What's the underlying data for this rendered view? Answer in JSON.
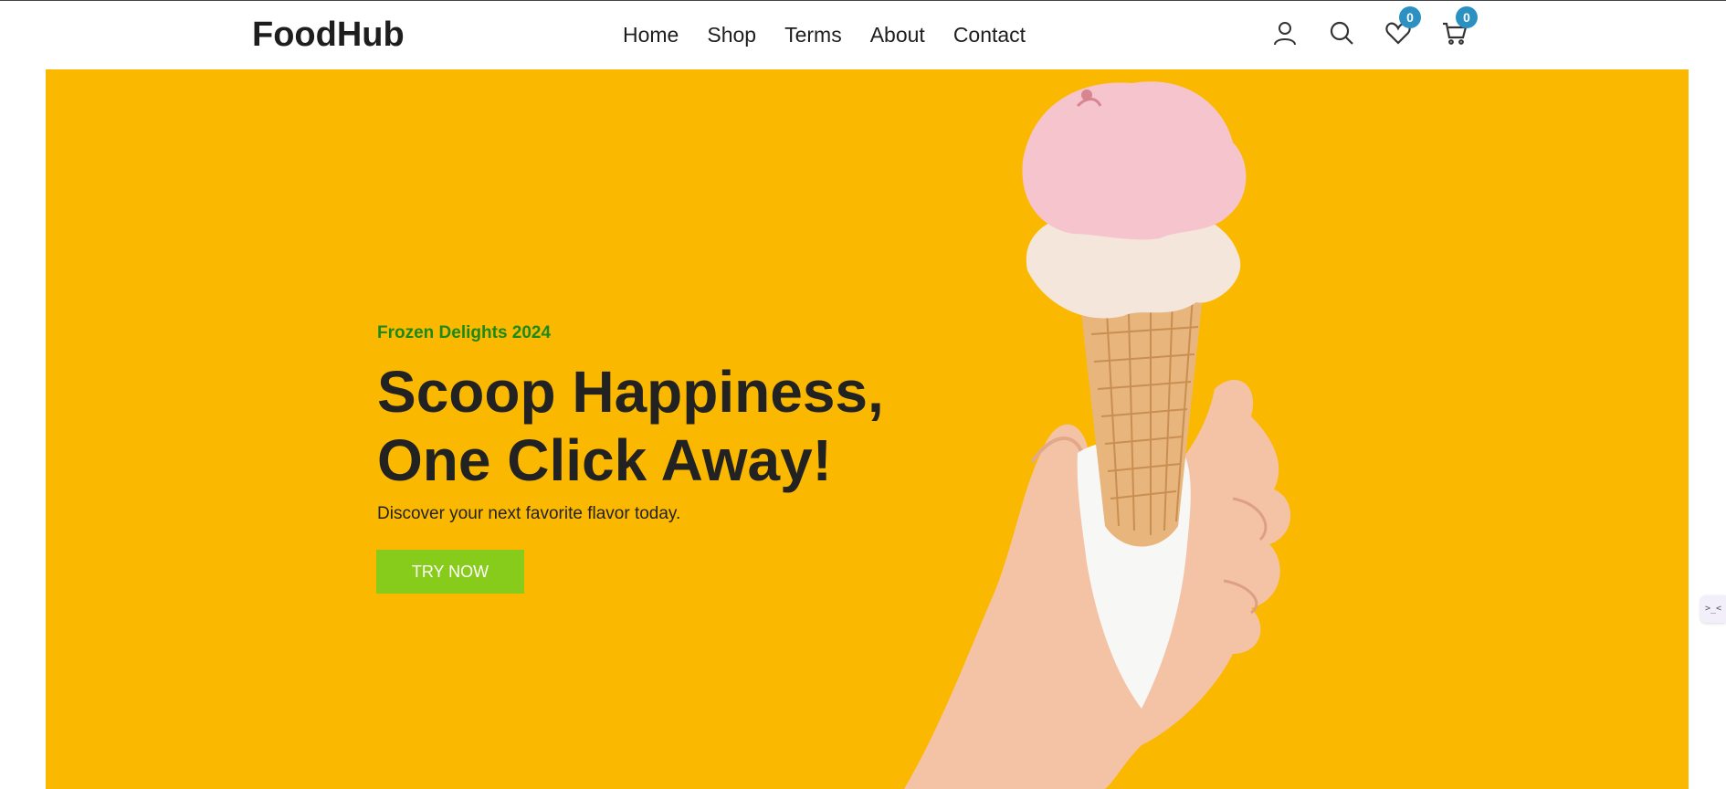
{
  "brand": {
    "name": "FoodHub"
  },
  "nav": {
    "items": [
      {
        "label": "Home"
      },
      {
        "label": "Shop"
      },
      {
        "label": "Terms"
      },
      {
        "label": "About"
      },
      {
        "label": "Contact"
      }
    ]
  },
  "header_icons": {
    "account": "user-icon",
    "search": "search-icon",
    "wishlist": "heart-icon",
    "wishlist_count": "0",
    "cart": "cart-icon",
    "cart_count": "0"
  },
  "hero": {
    "eyebrow": "Frozen Delights 2024",
    "headline_line1": "Scoop Happiness,",
    "headline_line2": "One Click Away!",
    "subtext": "Discover your next favorite flavor today.",
    "cta_label": "TRY NOW",
    "image": "ice-cream-cone-in-hand"
  },
  "side_widget": {
    "glyph": ">_<",
    "icon": "assistant-icon"
  },
  "colors": {
    "hero_background": "#fbb800",
    "eyebrow_green": "#1b8a1b",
    "cta_green": "#88cc1b",
    "badge_blue": "#2a91c2",
    "text_dark": "#222222"
  }
}
